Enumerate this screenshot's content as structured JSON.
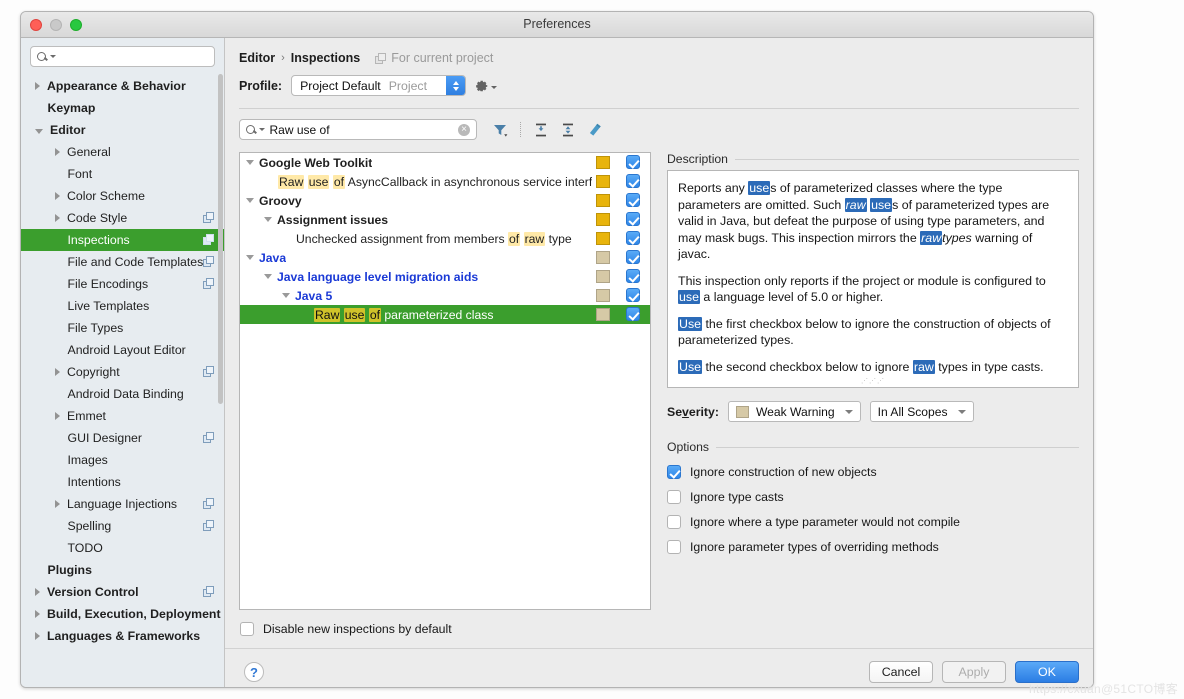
{
  "window": {
    "title": "Preferences"
  },
  "sidebar": {
    "search_placeholder": "",
    "search_value": "",
    "items": [
      {
        "label": "Appearance & Behavior",
        "level": 1,
        "bold": true,
        "arrow": "closed",
        "badge": false
      },
      {
        "label": "Keymap",
        "level": 1,
        "bold": true,
        "arrow": "none",
        "badge": false
      },
      {
        "label": "Editor",
        "level": 1,
        "bold": true,
        "arrow": "open",
        "badge": false
      },
      {
        "label": "General",
        "level": 2,
        "bold": false,
        "arrow": "closed",
        "badge": false
      },
      {
        "label": "Font",
        "level": 2,
        "bold": false,
        "arrow": "none",
        "badge": false
      },
      {
        "label": "Color Scheme",
        "level": 2,
        "bold": false,
        "arrow": "closed",
        "badge": false
      },
      {
        "label": "Code Style",
        "level": 2,
        "bold": false,
        "arrow": "closed",
        "badge": true
      },
      {
        "label": "Inspections",
        "level": 2,
        "bold": false,
        "arrow": "none",
        "badge": true,
        "selected": true
      },
      {
        "label": "File and Code Templates",
        "level": 2,
        "bold": false,
        "arrow": "none",
        "badge": true
      },
      {
        "label": "File Encodings",
        "level": 2,
        "bold": false,
        "arrow": "none",
        "badge": true
      },
      {
        "label": "Live Templates",
        "level": 2,
        "bold": false,
        "arrow": "none",
        "badge": false
      },
      {
        "label": "File Types",
        "level": 2,
        "bold": false,
        "arrow": "none",
        "badge": false
      },
      {
        "label": "Android Layout Editor",
        "level": 2,
        "bold": false,
        "arrow": "none",
        "badge": false
      },
      {
        "label": "Copyright",
        "level": 2,
        "bold": false,
        "arrow": "closed",
        "badge": true
      },
      {
        "label": "Android Data Binding",
        "level": 2,
        "bold": false,
        "arrow": "none",
        "badge": false
      },
      {
        "label": "Emmet",
        "level": 2,
        "bold": false,
        "arrow": "closed",
        "badge": false
      },
      {
        "label": "GUI Designer",
        "level": 2,
        "bold": false,
        "arrow": "none",
        "badge": true
      },
      {
        "label": "Images",
        "level": 2,
        "bold": false,
        "arrow": "none",
        "badge": false
      },
      {
        "label": "Intentions",
        "level": 2,
        "bold": false,
        "arrow": "none",
        "badge": false
      },
      {
        "label": "Language Injections",
        "level": 2,
        "bold": false,
        "arrow": "closed",
        "badge": true
      },
      {
        "label": "Spelling",
        "level": 2,
        "bold": false,
        "arrow": "none",
        "badge": true
      },
      {
        "label": "TODO",
        "level": 2,
        "bold": false,
        "arrow": "none",
        "badge": false
      },
      {
        "label": "Plugins",
        "level": 1,
        "bold": true,
        "arrow": "none",
        "badge": false
      },
      {
        "label": "Version Control",
        "level": 1,
        "bold": true,
        "arrow": "closed",
        "badge": true
      },
      {
        "label": "Build, Execution, Deployment",
        "level": 1,
        "bold": true,
        "arrow": "closed",
        "badge": false
      },
      {
        "label": "Languages & Frameworks",
        "level": 1,
        "bold": true,
        "arrow": "closed",
        "badge": false
      }
    ]
  },
  "breadcrumb": {
    "parent": "Editor",
    "separator": "›",
    "current": "Inspections",
    "scope_note": "For current project"
  },
  "profile": {
    "label": "Profile:",
    "value": "Project Default",
    "scope": "Project",
    "gear_icon": "gear-icon"
  },
  "filterbar": {
    "search_value": "Raw use of",
    "clear_glyph": "×",
    "icons": [
      "filter-icon",
      "expand-all-icon",
      "collapse-all-icon",
      "reset-icon"
    ]
  },
  "tree": {
    "rows": [
      {
        "indent": 0,
        "arrow": "open",
        "bold": true,
        "blue": false,
        "severity": "#E8B40C",
        "checked": true,
        "parts": [
          {
            "t": "Google Web Toolkit",
            "hl": false
          }
        ]
      },
      {
        "indent": 1,
        "arrow": "none",
        "bold": false,
        "blue": false,
        "severity": "#E8B40C",
        "checked": true,
        "parts": [
          {
            "t": "Raw",
            "hl": true
          },
          {
            "t": " ",
            "hl": false
          },
          {
            "t": "use",
            "hl": true
          },
          {
            "t": " ",
            "hl": false
          },
          {
            "t": "of",
            "hl": true
          },
          {
            "t": " AsyncCallback in asynchronous service interf",
            "hl": false
          }
        ]
      },
      {
        "indent": 0,
        "arrow": "open",
        "bold": true,
        "blue": false,
        "severity": "#E8B40C",
        "checked": true,
        "parts": [
          {
            "t": "Groovy",
            "hl": false
          }
        ]
      },
      {
        "indent": 1,
        "arrow": "open",
        "bold": true,
        "blue": false,
        "severity": "#E8B40C",
        "checked": true,
        "parts": [
          {
            "t": "Assignment issues",
            "hl": false
          }
        ]
      },
      {
        "indent": 2,
        "arrow": "none",
        "bold": false,
        "blue": false,
        "severity": "#E8B40C",
        "checked": true,
        "parts": [
          {
            "t": "Unchecked assignment from members ",
            "hl": false
          },
          {
            "t": "of",
            "hl": true
          },
          {
            "t": " ",
            "hl": false
          },
          {
            "t": "raw",
            "hl": true
          },
          {
            "t": " type",
            "hl": false
          }
        ]
      },
      {
        "indent": 0,
        "arrow": "open",
        "bold": true,
        "blue": true,
        "severity": "#D6C9A6",
        "checked": true,
        "parts": [
          {
            "t": "Java",
            "hl": false
          }
        ]
      },
      {
        "indent": 1,
        "arrow": "open",
        "bold": true,
        "blue": true,
        "severity": "#D6C9A6",
        "checked": true,
        "parts": [
          {
            "t": "Java language level migration aids",
            "hl": false
          }
        ]
      },
      {
        "indent": 2,
        "arrow": "open",
        "bold": true,
        "blue": true,
        "severity": "#D6C9A6",
        "checked": true,
        "parts": [
          {
            "t": "Java 5",
            "hl": false
          }
        ]
      },
      {
        "indent": 3,
        "arrow": "none",
        "bold": false,
        "blue": false,
        "severity": "#D6C9A6",
        "checked": true,
        "selected": true,
        "parts": [
          {
            "t": "Raw",
            "hl": true
          },
          {
            "t": " ",
            "hl": false
          },
          {
            "t": "use",
            "hl": true
          },
          {
            "t": " ",
            "hl": false
          },
          {
            "t": "of",
            "hl": true
          },
          {
            "t": " parameterized class",
            "hl": false
          }
        ]
      }
    ]
  },
  "description": {
    "title": "Description",
    "paragraphs": [
      [
        {
          "t": "Reports any ",
          "h": false
        },
        {
          "t": "use",
          "h": true
        },
        {
          "t": "s of parameterized classes where the type parameters are omitted. Such ",
          "h": false
        },
        {
          "t": "raw",
          "h": true,
          "i": true
        },
        {
          "t": " ",
          "h": false
        },
        {
          "t": "use",
          "h": true
        },
        {
          "t": "s of parameterized types are valid in Java, but defeat the purpose of using type parameters, and may mask bugs. This inspection mirrors the ",
          "h": false
        },
        {
          "t": "raw",
          "h": true,
          "i": true
        },
        {
          "t": "types",
          "h": false,
          "i": true
        },
        {
          "t": " warning of javac.",
          "h": false
        }
      ],
      [
        {
          "t": "This inspection only reports if the project or module is configured to ",
          "h": false
        },
        {
          "t": "use",
          "h": true
        },
        {
          "t": " a language level of 5.0 or higher.",
          "h": false
        }
      ],
      [
        {
          "t": "Use",
          "h": true
        },
        {
          "t": " the first checkbox below to ignore the construction of objects of parameterized types.",
          "h": false
        }
      ],
      [
        {
          "t": "Use",
          "h": true
        },
        {
          "t": " the second checkbox below to ignore ",
          "h": false
        },
        {
          "t": "raw",
          "h": true
        },
        {
          "t": " types in type casts.",
          "h": false
        }
      ]
    ]
  },
  "severity": {
    "label_pre": "Se",
    "label_accel": "v",
    "label_post": "erity:",
    "value": "Weak Warning",
    "swatch_color": "#D6C9A6",
    "scope_value": "In All Scopes"
  },
  "options": {
    "title": "Options",
    "items": [
      {
        "label": "Ignore construction of new objects",
        "checked": true
      },
      {
        "label": "Ignore type casts",
        "checked": false
      },
      {
        "label": "Ignore where a type parameter would not compile",
        "checked": false
      },
      {
        "label": "Ignore parameter types of overriding methods",
        "checked": false
      }
    ]
  },
  "bottom": {
    "disable_new_label": "Disable new inspections by default",
    "disable_new_checked": false,
    "help_glyph": "?",
    "cancel": "Cancel",
    "apply": "Apply",
    "ok": "OK"
  },
  "watermark": "https://cxuan@51CTO博客"
}
